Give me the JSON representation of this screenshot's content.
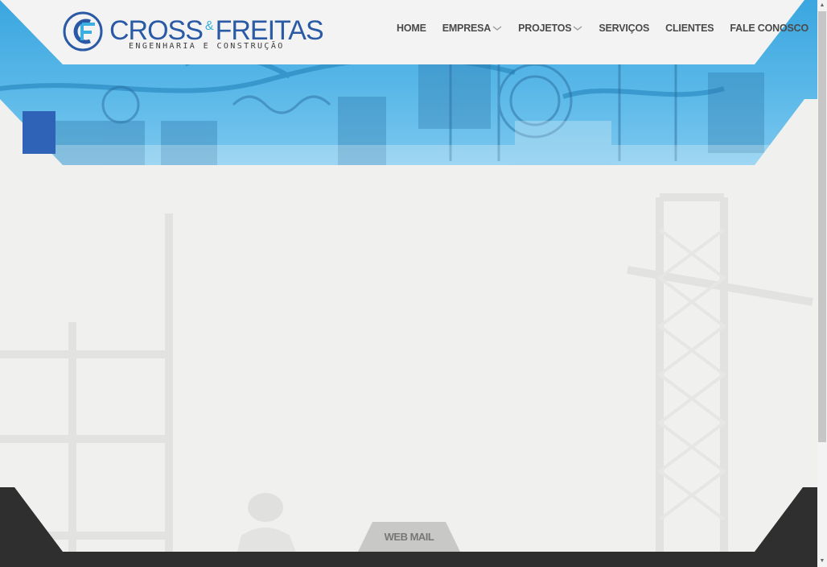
{
  "brand": {
    "name_part1": "CROSS",
    "amp": "&",
    "name_part2": "FREITAS",
    "tagline": "ENGENHARIA E CONSTRUÇÃO",
    "primary_color": "#2a5aa6",
    "accent_color": "#3ab0e0"
  },
  "nav": {
    "items": [
      {
        "label": "HOME",
        "has_dropdown": false
      },
      {
        "label": "EMPRESA",
        "has_dropdown": true
      },
      {
        "label": "PROJETOS",
        "has_dropdown": true
      },
      {
        "label": "SERVIÇOS",
        "has_dropdown": false
      },
      {
        "label": "CLIENTES",
        "has_dropdown": false
      },
      {
        "label": "FALE CONOSCO",
        "has_dropdown": false
      }
    ]
  },
  "footer": {
    "webmail_label": "WEB MAIL",
    "bar_color": "#2f2f2f"
  },
  "icons": {
    "logo": "cf-logo-icon",
    "dropdown": "chevron-down-icon",
    "scroll_up": "arrow-up-icon",
    "scroll_down": "arrow-down-icon"
  }
}
